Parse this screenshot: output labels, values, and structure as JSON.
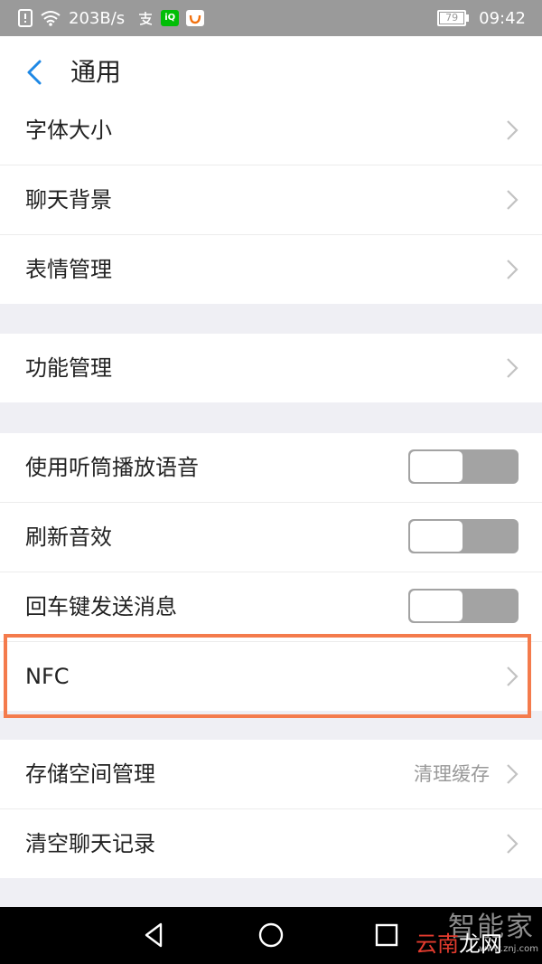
{
  "status_bar": {
    "speed": "203B/s",
    "battery": "79",
    "time": "09:42",
    "icons": [
      "sim-alert-icon",
      "wifi-icon",
      "alipay-icon",
      "iqiyi-icon",
      "didi-icon"
    ]
  },
  "header": {
    "title": "通用",
    "back_icon": "back-chevron-icon",
    "accent": "#1e88e5"
  },
  "groups": {
    "display": {
      "items": [
        {
          "label": "字体大小"
        },
        {
          "label": "聊天背景"
        },
        {
          "label": "表情管理"
        }
      ]
    },
    "function": {
      "items": [
        {
          "label": "功能管理"
        }
      ]
    },
    "sound": {
      "items": [
        {
          "label": "使用听筒播放语音",
          "toggle": false
        },
        {
          "label": "刷新音效",
          "toggle": false
        },
        {
          "label": "回车键发送消息",
          "toggle": false
        },
        {
          "label": "NFC"
        }
      ]
    },
    "storage": {
      "items": [
        {
          "label": "存储空间管理",
          "value": "清理缓存"
        },
        {
          "label": "清空聊天记录"
        }
      ]
    }
  },
  "highlight_color": "#f47b4c",
  "nav": {
    "buttons": [
      "back-triangle-icon",
      "home-circle-icon",
      "recents-square-icon"
    ]
  },
  "watermark": {
    "top": "智能家",
    "bottom_red": "云南",
    "bottom_white": "龙网",
    "url": "www.znj.com"
  }
}
